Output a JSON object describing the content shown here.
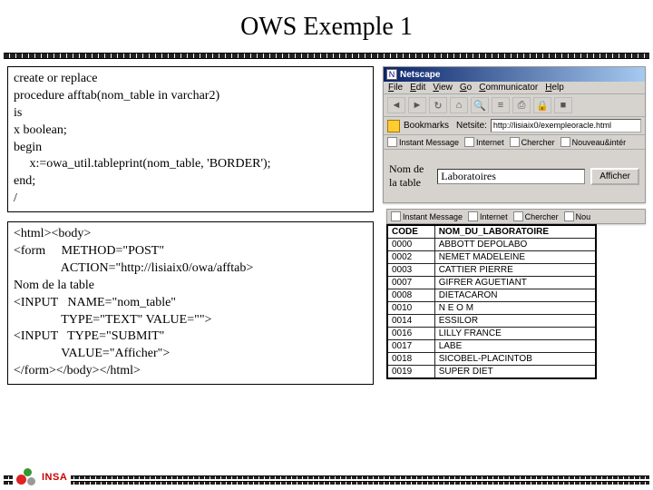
{
  "title": "OWS Exemple 1",
  "code_box_1": "create or replace\nprocedure afftab(nom_table in varchar2)\nis\nx boolean;\nbegin\n     x:=owa_util.tableprint(nom_table, 'BORDER');\nend;\n/",
  "code_box_2": "<html><body>\n<form     METHOD=\"POST\"\n               ACTION=\"http://lisiaix0/owa/afftab>\nNom de la table\n<INPUT   NAME=\"nom_table\"\n               TYPE=\"TEXT\" VALUE=\"\">\n<INPUT   TYPE=\"SUBMIT\"\n               VALUE=\"Afficher\">\n</form></body></html>",
  "browser": {
    "app": "Netscape",
    "menus": [
      "File",
      "Edit",
      "View",
      "Go",
      "Communicator",
      "Help"
    ],
    "bookmarks_label": "Bookmarks",
    "location_label": "Netsite:",
    "url": "http://lisiaix0/exempleoracle.html",
    "linkbar": [
      "Instant Message",
      "Internet",
      "Chercher",
      "Nouveau&intér"
    ],
    "form_label": "Nom de la table",
    "form_value": "Laboratoires",
    "form_button": "Afficher"
  },
  "browser2_linkbar": [
    "Instant Message",
    "Internet",
    "Chercher",
    "Nou"
  ],
  "table": {
    "headers": [
      "CODE",
      "NOM_DU_LABORATOIRE"
    ],
    "rows": [
      [
        "0000",
        "ABBOTT DEPOLABO"
      ],
      [
        "0002",
        "NEMET MADELEINE"
      ],
      [
        "0003",
        "CATTIER PIERRE"
      ],
      [
        "0007",
        "GIFRER AGUETIANT"
      ],
      [
        "0008",
        "DIETACARON"
      ],
      [
        "0010",
        "N E O M"
      ],
      [
        "0014",
        "ESSILOR"
      ],
      [
        "0016",
        "LILLY FRANCE"
      ],
      [
        "0017",
        "LABE"
      ],
      [
        "0018",
        "SICOBEL-PLACINTOB"
      ],
      [
        "0019",
        "SUPER DIET"
      ]
    ]
  },
  "logo_text": "INSA"
}
